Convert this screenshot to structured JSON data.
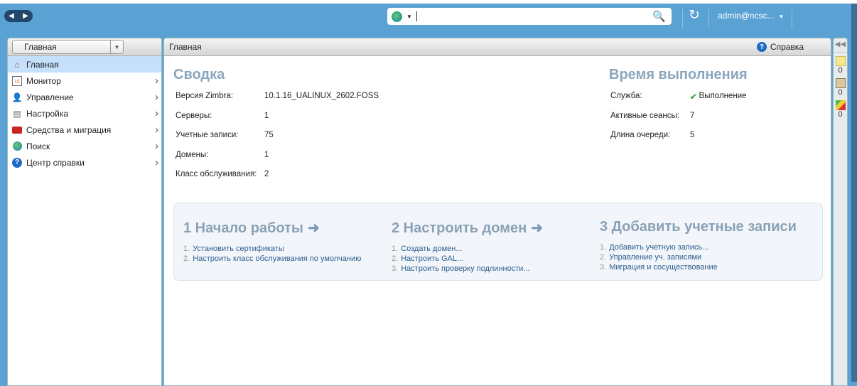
{
  "topbar": {
    "search_placeholder": "",
    "user": "admin@ncsc...",
    "refresh": "↻"
  },
  "sidebar": {
    "breadcrumb": "Главная",
    "items": [
      {
        "label": "Главная",
        "icon": "home-icon"
      },
      {
        "label": "Монитор",
        "icon": "monitor-icon"
      },
      {
        "label": "Управление",
        "icon": "manage-icon"
      },
      {
        "label": "Настройка",
        "icon": "configure-icon"
      },
      {
        "label": "Средства и миграция",
        "icon": "toolbox-icon"
      },
      {
        "label": "Поиск",
        "icon": "search-icon"
      },
      {
        "label": "Центр справки",
        "icon": "help-icon"
      }
    ]
  },
  "main": {
    "header": "Главная",
    "help": "Справка",
    "summary": {
      "title": "Сводка",
      "rows": [
        {
          "k": "Версия Zimbra:",
          "v": "10.1.16_UALINUX_2602.FOSS"
        },
        {
          "k": "Серверы:",
          "v": "1"
        },
        {
          "k": "Учетные записи:",
          "v": "75"
        },
        {
          "k": "Домены:",
          "v": "1"
        },
        {
          "k": "Класс обслуживания:",
          "v": "2"
        }
      ]
    },
    "runtime": {
      "title": "Время выполнения",
      "rows": [
        {
          "k": "Служба:",
          "v": "Выполнение"
        },
        {
          "k": "Активные сеансы:",
          "v": "7"
        },
        {
          "k": "Длина очереди:",
          "v": "5"
        }
      ]
    },
    "steps": [
      {
        "title": "1 Начало работы",
        "items": [
          "Установить сертификаты",
          "Настроить класс обслуживания по умолчанию"
        ]
      },
      {
        "title": "2 Настроить домен",
        "items": [
          "Создать домен...",
          "Настроить GAL...",
          "Настроить проверку подлинности..."
        ]
      },
      {
        "title": "3 Добавить учетные записи",
        "items": [
          "Добавить учетную запись...",
          "Управление уч. записями",
          "Миграция и сосуществование"
        ]
      }
    ]
  },
  "right": {
    "counts": [
      "0",
      "0",
      "0"
    ]
  }
}
